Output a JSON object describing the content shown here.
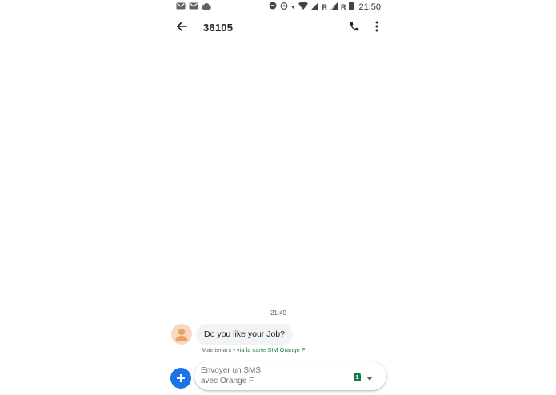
{
  "status_bar": {
    "time": "21:50",
    "roaming_1": "R",
    "roaming_2": "R",
    "left_icons": [
      "gmail-icon",
      "gmail-icon",
      "cloud-icon"
    ],
    "right_icons": [
      "do-not-disturb-icon",
      "alarm-icon",
      "wifi-icon",
      "signal-icon",
      "signal-icon",
      "battery-icon"
    ]
  },
  "toolbar": {
    "title": "36105"
  },
  "conversation": {
    "timestamp": "21:49",
    "messages": [
      {
        "text": "Do you like your Job?",
        "meta_time": "Maintenant",
        "meta_sim": " • via la carte SIM Orange F"
      }
    ]
  },
  "compose": {
    "placeholder_line1": "Envoyer un SMS",
    "placeholder_line2": "avec Orange F",
    "sim_number": "1"
  },
  "colors": {
    "accent": "#1a73e8",
    "sim_green": "#0b8043",
    "bubble": "#f1f3f4",
    "avatar_bg": "#f8d9c0",
    "avatar_fg": "#e8a263"
  }
}
